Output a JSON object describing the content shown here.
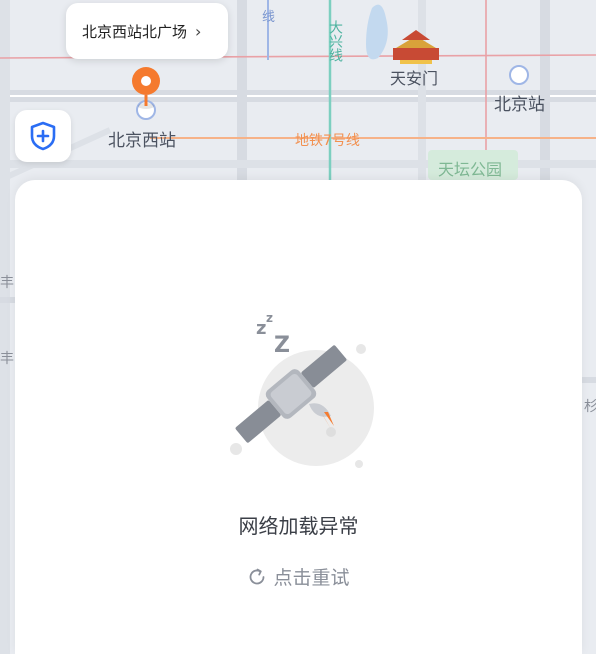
{
  "map": {
    "labels": {
      "station_west": "北京西站",
      "tiananmen": "天安门",
      "station_beijing": "北京站",
      "subway7": "地铁7号线",
      "park": "天坛公园",
      "daxing_line": "大兴线",
      "xian": "线",
      "edge_left1": "丰",
      "edge_left2": "丰",
      "edge_right": "杉"
    }
  },
  "location_bubble": {
    "title": "北京西站北广场",
    "chevron": "›"
  },
  "safety_button": {
    "icon": "shield-plus-icon"
  },
  "error_panel": {
    "message": "网络加载异常",
    "retry_label": "点击重试",
    "illustration": "sleeping-satellite-moon",
    "zzz": "z Z"
  },
  "colors": {
    "pin": "#f57a2e",
    "shield": "#2a6df4",
    "sheet": "#ffffff",
    "map_bg": "#e9ecf1"
  }
}
